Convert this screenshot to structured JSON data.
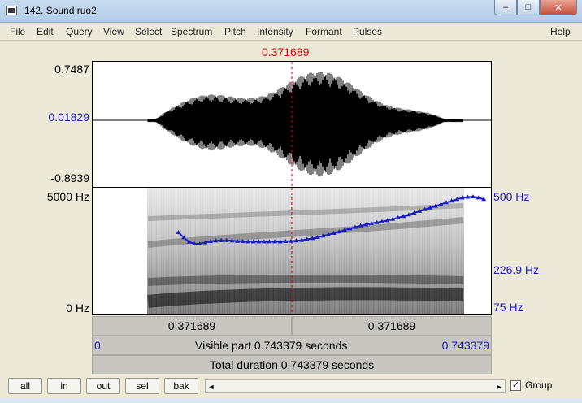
{
  "window": {
    "title": "142. Sound ruo2",
    "minimize_glyph": "–",
    "maximize_glyph": "□",
    "close_glyph": "✕"
  },
  "menu": [
    "File",
    "Edit",
    "Query",
    "View",
    "Select",
    "Spectrum",
    "Pitch",
    "Intensity",
    "Formant",
    "Pulses",
    "Help"
  ],
  "cursor": {
    "time_label": "0.371689",
    "time_seconds": 0.371689,
    "color": "#e00000"
  },
  "waveform": {
    "max_label": "0.7487",
    "mid_label": "0.01829",
    "min_label": "-0.8939",
    "max": 0.7487,
    "mid": 0.01829,
    "min": -0.8939
  },
  "spectrogram": {
    "freq_top_label": "5000 Hz",
    "freq_bottom_label": "0 Hz",
    "pitch_top_label": "500 Hz",
    "pitch_cursor_label": "226.9 Hz",
    "pitch_bottom_label": "75 Hz"
  },
  "chart_data": {
    "type": "line",
    "series": [
      {
        "x": [
          0.16,
          0.17,
          0.18,
          0.19,
          0.2,
          0.21,
          0.22,
          0.23,
          0.24,
          0.25,
          0.26,
          0.27,
          0.28,
          0.29,
          0.3,
          0.31,
          0.32,
          0.33,
          0.34,
          0.35,
          0.36,
          0.37,
          0.38,
          0.39,
          0.4,
          0.41,
          0.42,
          0.43,
          0.44,
          0.45,
          0.46,
          0.47,
          0.48,
          0.49,
          0.5,
          0.51,
          0.52,
          0.53,
          0.54,
          0.55,
          0.56,
          0.57,
          0.58,
          0.59,
          0.6,
          0.61,
          0.62,
          0.63,
          0.64,
          0.65,
          0.66,
          0.67,
          0.68,
          0.69,
          0.7,
          0.71,
          0.72,
          0.73
        ],
        "y": [
          256,
          237,
          222,
          216,
          216,
          220,
          224,
          226,
          227,
          227,
          226,
          225,
          224,
          223,
          223,
          223,
          223,
          223,
          223,
          223,
          224,
          225,
          226,
          228,
          231,
          234,
          238,
          243,
          248,
          253,
          259,
          265,
          271,
          277,
          283,
          288,
          293,
          297,
          301,
          306,
          312,
          319,
          326,
          334,
          343,
          352,
          361,
          370,
          380,
          390,
          400,
          410,
          420,
          430,
          435,
          437,
          430,
          420
        ]
      }
    ],
    "xlim": [
      0,
      0.743379
    ],
    "ylim": [
      75,
      500
    ],
    "yscale": "log",
    "line_color": "#1d1dc6"
  },
  "selection": {
    "left_label": "0.371689",
    "right_label": "0.371689"
  },
  "visible": {
    "start": "0",
    "label": "Visible part 0.743379 seconds",
    "end": "0.743379"
  },
  "total": {
    "label": "Total duration 0.743379 seconds"
  },
  "buttons": [
    "all",
    "in",
    "out",
    "sel",
    "bak"
  ],
  "scroll": {
    "left_glyph": "◄",
    "right_glyph": "►"
  },
  "group": {
    "label": "Group",
    "checked": "✓"
  }
}
